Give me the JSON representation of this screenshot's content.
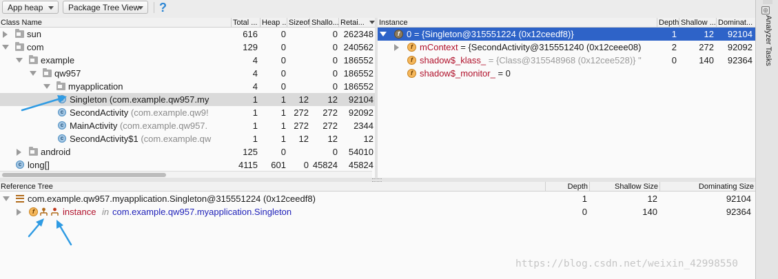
{
  "toolbar": {
    "heap_select": "App heap",
    "view_select": "Package Tree View",
    "help_label": "?"
  },
  "class_panel": {
    "columns": [
      "Class Name",
      "Total ...",
      "Heap ...",
      "Sizeof",
      "Shallo...",
      "Retai..."
    ],
    "rows": [
      {
        "name": "sun",
        "detail": "",
        "total": "616",
        "heap": "0",
        "sizeof": "",
        "shallow": "0",
        "retained": "262348",
        "kind": "folder",
        "expand": "right",
        "level": 0
      },
      {
        "name": "com",
        "detail": "",
        "total": "129",
        "heap": "0",
        "sizeof": "",
        "shallow": "0",
        "retained": "240562",
        "kind": "folder",
        "expand": "down",
        "level": 0
      },
      {
        "name": "example",
        "detail": "",
        "total": "4",
        "heap": "0",
        "sizeof": "",
        "shallow": "0",
        "retained": "186552",
        "kind": "folder",
        "expand": "down",
        "level": 1
      },
      {
        "name": "qw957",
        "detail": "",
        "total": "4",
        "heap": "0",
        "sizeof": "",
        "shallow": "0",
        "retained": "186552",
        "kind": "folder",
        "expand": "down",
        "level": 2
      },
      {
        "name": "myapplication",
        "detail": "",
        "total": "4",
        "heap": "0",
        "sizeof": "",
        "shallow": "0",
        "retained": "186552",
        "kind": "folder",
        "expand": "down",
        "level": 3
      },
      {
        "name": "Singleton",
        "detail": "(com.example.qw957.my",
        "total": "1",
        "heap": "1",
        "sizeof": "12",
        "shallow": "12",
        "retained": "92104",
        "kind": "class",
        "expand": "none",
        "level": 4,
        "selected": true
      },
      {
        "name": "SecondActivity",
        "detail": "(com.example.qw9!",
        "total": "1",
        "heap": "1",
        "sizeof": "272",
        "shallow": "272",
        "retained": "92092",
        "kind": "class",
        "expand": "none",
        "level": 4
      },
      {
        "name": "MainActivity",
        "detail": "(com.example.qw957.",
        "total": "1",
        "heap": "1",
        "sizeof": "272",
        "shallow": "272",
        "retained": "2344",
        "kind": "class",
        "expand": "none",
        "level": 4
      },
      {
        "name": "SecondActivity$1",
        "detail": "(com.example.qw",
        "total": "1",
        "heap": "1",
        "sizeof": "12",
        "shallow": "12",
        "retained": "12",
        "kind": "class",
        "expand": "none",
        "level": 4
      },
      {
        "name": "android",
        "detail": "",
        "total": "125",
        "heap": "0",
        "sizeof": "",
        "shallow": "0",
        "retained": "54010",
        "kind": "folder",
        "expand": "right",
        "level": 1
      },
      {
        "name": "long[]",
        "detail": "",
        "total": "4115",
        "heap": "601",
        "sizeof": "0",
        "shallow": "45824",
        "retained": "45824",
        "kind": "class",
        "expand": "none",
        "level": 0
      }
    ]
  },
  "instance_panel": {
    "columns": [
      "Instance",
      "Depth",
      "Shallow ...",
      "Dominat..."
    ],
    "rows": [
      {
        "text": "0 = {Singleton@315551224 (0x12ceedf8)}",
        "detail": "",
        "depth": "1",
        "shallow": "12",
        "dominating": "92104",
        "icon": "f",
        "expand": "down",
        "selected": true
      },
      {
        "text": "mContext",
        "detail": " = {SecondActivity@315551240 (0x12ceee08)",
        "depth": "2",
        "shallow": "272",
        "dominating": "92092",
        "icon": "f",
        "expand": "right"
      },
      {
        "text": "shadow$_klass_",
        "detail": " = {Class@315548968 (0x12cee528)} \"",
        "depth": "0",
        "shallow": "140",
        "dominating": "92364",
        "icon": "f",
        "expand": "none"
      },
      {
        "text": "shadow$_monitor_",
        "detail": " = 0",
        "depth": "",
        "shallow": "",
        "dominating": "",
        "icon": "f",
        "expand": "none"
      }
    ]
  },
  "reference_panel": {
    "columns": [
      "Reference Tree",
      "Depth",
      "Shallow Size",
      "Dominating Size"
    ],
    "rows": [
      {
        "text": "com.example.qw957.myapplication.Singleton@315551224 (0x12ceedf8)",
        "depth": "1",
        "shallow": "12",
        "dominating": "92104"
      },
      {
        "field": "instance",
        "in_word": "in",
        "owner": "com.example.qw957.myapplication.Singleton",
        "depth": "0",
        "shallow": "140",
        "dominating": "92364"
      }
    ]
  },
  "side_panel": {
    "label": "Analyzer Tasks"
  },
  "watermark": "https://blog.csdn.net/weixin_42998550",
  "colors": {
    "selection": "#2e63c8",
    "annotation_arrow": "#2f9be3",
    "field_icon": "#f5b75b",
    "class_icon": "#a3c6e3",
    "reference_blue": "#1d1fb8",
    "field_red": "#b0102a"
  }
}
